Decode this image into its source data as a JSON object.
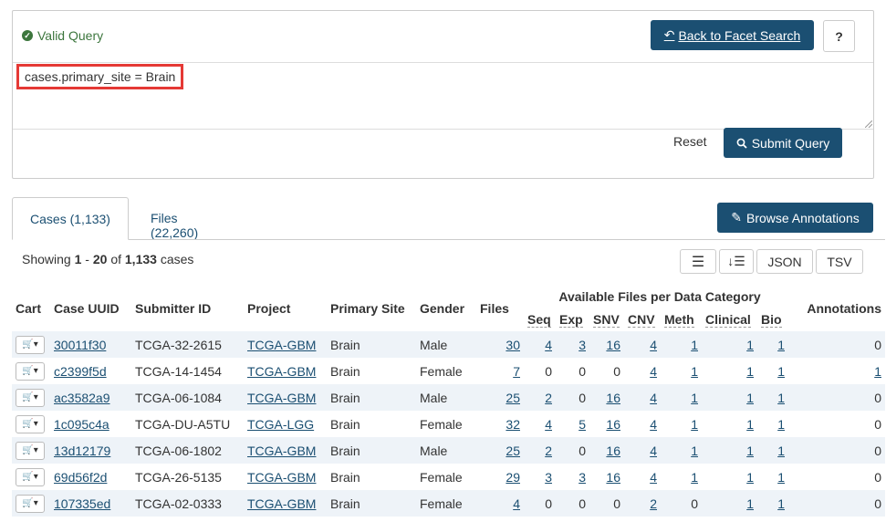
{
  "query": {
    "status": "Valid Query",
    "text": "cases.primary_site = Brain",
    "back_label": "Back to Facet Search",
    "help_label": "?",
    "reset_label": "Reset",
    "submit_label": "Submit Query"
  },
  "tabs": [
    {
      "label": "Cases (1,133)"
    },
    {
      "label": "Files (22,260)"
    }
  ],
  "browse_label": "Browse Annotations",
  "showing": {
    "prefix": "Showing",
    "from": "1",
    "sep": "-",
    "to": "20",
    "of": "of",
    "total": "1,133",
    "suffix": "cases"
  },
  "tools": {
    "json": "JSON",
    "tsv": "TSV"
  },
  "table": {
    "headers": {
      "cart": "Cart",
      "uuid": "Case UUID",
      "submitter": "Submitter ID",
      "project": "Project",
      "site": "Primary Site",
      "gender": "Gender",
      "files": "Files",
      "group": "Available Files per Data Category",
      "annotations": "Annotations",
      "sub": [
        "Seq",
        "Exp",
        "SNV",
        "CNV",
        "Meth",
        "Clinical",
        "Bio"
      ]
    },
    "rows": [
      {
        "uuid": "30011f30",
        "submitter": "TCGA-32-2615",
        "project": "TCGA-GBM",
        "site": "Brain",
        "gender": "Male",
        "files": "30",
        "seq": "4",
        "exp": "3",
        "snv": "16",
        "cnv": "4",
        "meth": "1",
        "clinical": "1",
        "bio": "1",
        "ann": "0"
      },
      {
        "uuid": "c2399f5d",
        "submitter": "TCGA-14-1454",
        "project": "TCGA-GBM",
        "site": "Brain",
        "gender": "Female",
        "files": "7",
        "seq": "0",
        "exp": "0",
        "snv": "0",
        "cnv": "4",
        "meth": "1",
        "clinical": "1",
        "bio": "1",
        "ann": "1"
      },
      {
        "uuid": "ac3582a9",
        "submitter": "TCGA-06-1084",
        "project": "TCGA-GBM",
        "site": "Brain",
        "gender": "Male",
        "files": "25",
        "seq": "2",
        "exp": "0",
        "snv": "16",
        "cnv": "4",
        "meth": "1",
        "clinical": "1",
        "bio": "1",
        "ann": "0"
      },
      {
        "uuid": "1c095c4a",
        "submitter": "TCGA-DU-A5TU",
        "project": "TCGA-LGG",
        "site": "Brain",
        "gender": "Female",
        "files": "32",
        "seq": "4",
        "exp": "5",
        "snv": "16",
        "cnv": "4",
        "meth": "1",
        "clinical": "1",
        "bio": "1",
        "ann": "0"
      },
      {
        "uuid": "13d12179",
        "submitter": "TCGA-06-1802",
        "project": "TCGA-GBM",
        "site": "Brain",
        "gender": "Male",
        "files": "25",
        "seq": "2",
        "exp": "0",
        "snv": "16",
        "cnv": "4",
        "meth": "1",
        "clinical": "1",
        "bio": "1",
        "ann": "0"
      },
      {
        "uuid": "69d56f2d",
        "submitter": "TCGA-26-5135",
        "project": "TCGA-GBM",
        "site": "Brain",
        "gender": "Female",
        "files": "29",
        "seq": "3",
        "exp": "3",
        "snv": "16",
        "cnv": "4",
        "meth": "1",
        "clinical": "1",
        "bio": "1",
        "ann": "0"
      },
      {
        "uuid": "107335ed",
        "submitter": "TCGA-02-0333",
        "project": "TCGA-GBM",
        "site": "Brain",
        "gender": "Female",
        "files": "4",
        "seq": "0",
        "exp": "0",
        "snv": "0",
        "cnv": "2",
        "meth": "0",
        "clinical": "1",
        "bio": "1",
        "ann": "0"
      }
    ]
  },
  "colors": {
    "primary": "#1b4f72",
    "valid": "#3c763d",
    "highlight": "#e53935"
  }
}
